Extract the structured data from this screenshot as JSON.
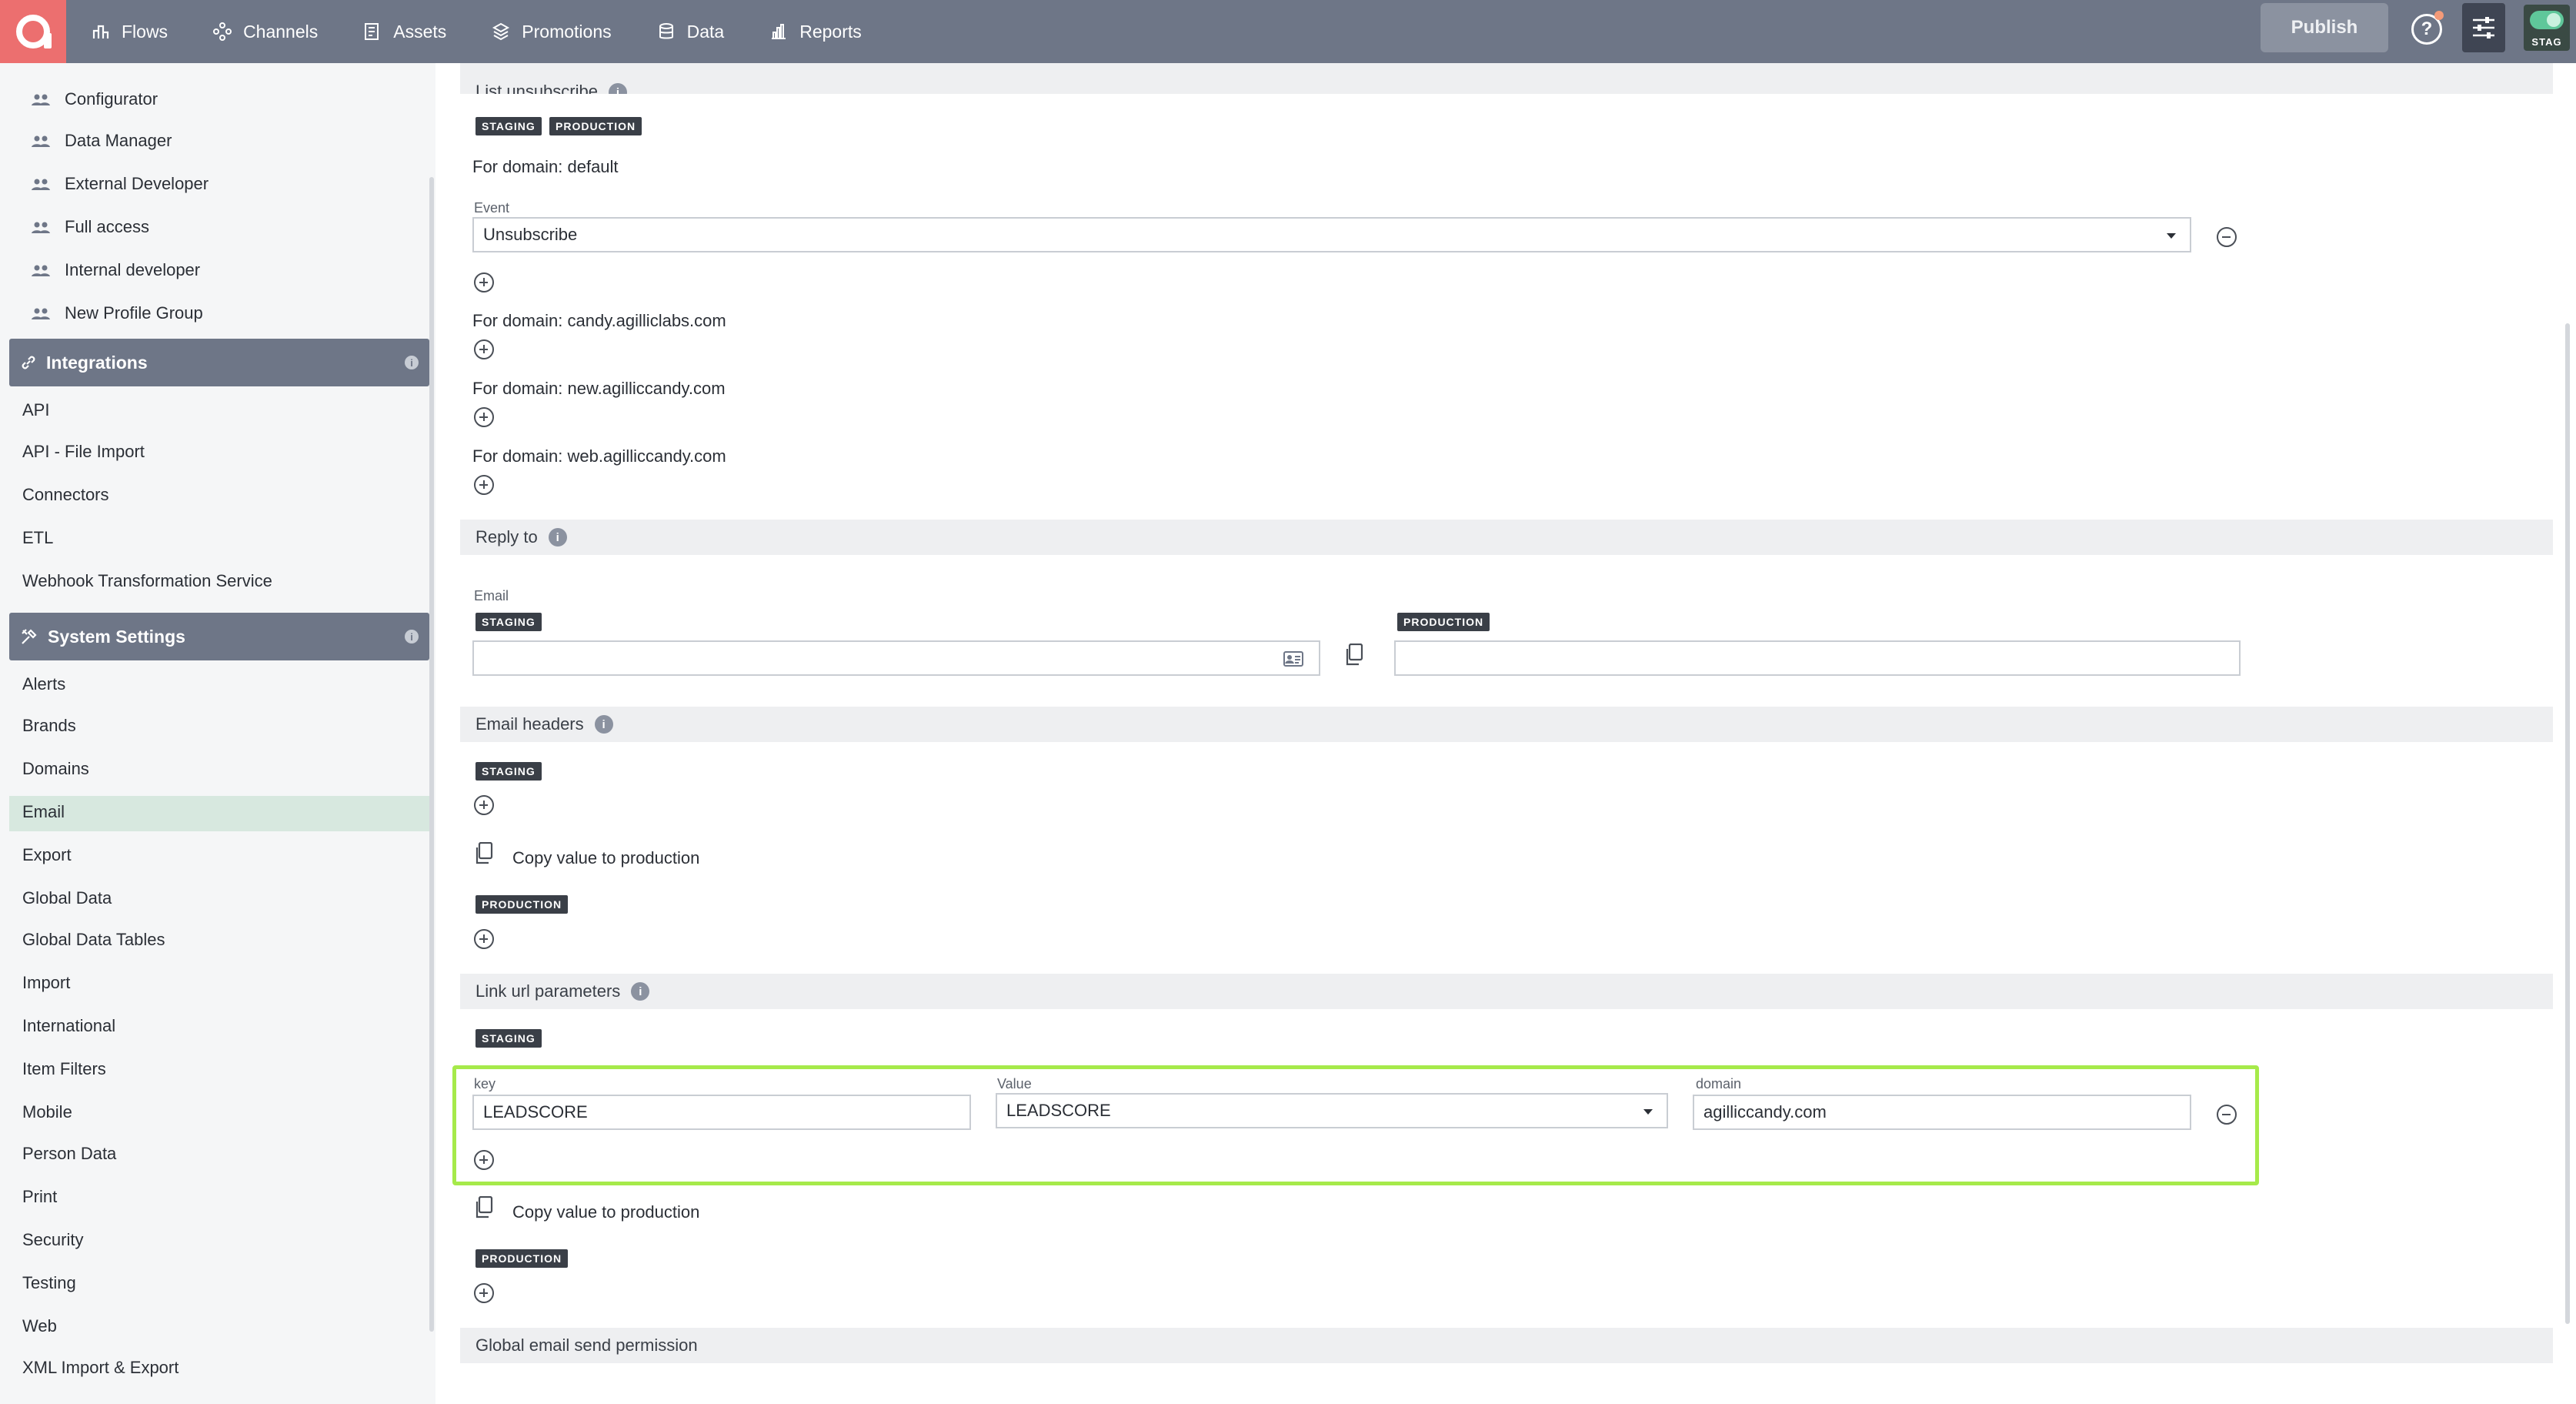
{
  "nav": {
    "items": [
      {
        "label": "Flows",
        "icon": "flows-icon"
      },
      {
        "label": "Channels",
        "icon": "channels-icon"
      },
      {
        "label": "Assets",
        "icon": "assets-icon"
      },
      {
        "label": "Promotions",
        "icon": "promotions-icon"
      },
      {
        "label": "Data",
        "icon": "data-icon"
      },
      {
        "label": "Reports",
        "icon": "reports-icon"
      }
    ],
    "publish_label": "Publish",
    "help_label": "?",
    "env_label": "STAG"
  },
  "sidebar": {
    "profile_groups": [
      "Configurator",
      "Data Manager",
      "External Developer",
      "Full access",
      "Internal developer",
      "New Profile Group"
    ],
    "integrations_title": "Integrations",
    "integrations_items": [
      "API",
      "API - File Import",
      "Connectors",
      "ETL",
      "Webhook Transformation Service"
    ],
    "system_title": "System Settings",
    "system_items": [
      "Alerts",
      "Brands",
      "Domains",
      "Email",
      "Export",
      "Global Data",
      "Global Data Tables",
      "Import",
      "International",
      "Item Filters",
      "Mobile",
      "Person Data",
      "Print",
      "Security",
      "Testing",
      "Web",
      "XML Import & Export"
    ],
    "active_item": "Email",
    "info_glyph": "i"
  },
  "main": {
    "list_unsubscribe": {
      "title": "List unsubscribe",
      "tag_staging": "STAGING",
      "tag_production": "PRODUCTION",
      "default_domain": "For domain: default",
      "event_label": "Event",
      "event_value": "Unsubscribe",
      "domain_1": "For domain: candy.agilliclabs.com",
      "domain_2": "For domain: new.agilliccandy.com",
      "domain_3": "For domain: web.agilliccandy.com"
    },
    "reply_to": {
      "title": "Reply to",
      "email_label": "Email",
      "tag_staging": "STAGING",
      "tag_production": "PRODUCTION",
      "staging_value": "",
      "production_value": ""
    },
    "email_headers": {
      "title": "Email headers",
      "tag_staging": "STAGING",
      "copy_label": "Copy value to production",
      "tag_production": "PRODUCTION"
    },
    "link_url_parameters": {
      "title": "Link url parameters",
      "tag_staging": "STAGING",
      "key_label": "key",
      "key_value": "LEADSCORE",
      "value_label": "Value",
      "value_value": "LEADSCORE",
      "domain_label": "domain",
      "domain_value": "agilliccandy.com",
      "copy_label": "Copy value to production",
      "tag_production": "PRODUCTION"
    },
    "global_email": {
      "title": "Global email send permission"
    },
    "info_glyph": "i"
  },
  "colors": {
    "topbar": "#6e7687",
    "logo": "#ec6f6f",
    "active_item": "#d7e8df",
    "highlight": "#a6ea4a"
  }
}
